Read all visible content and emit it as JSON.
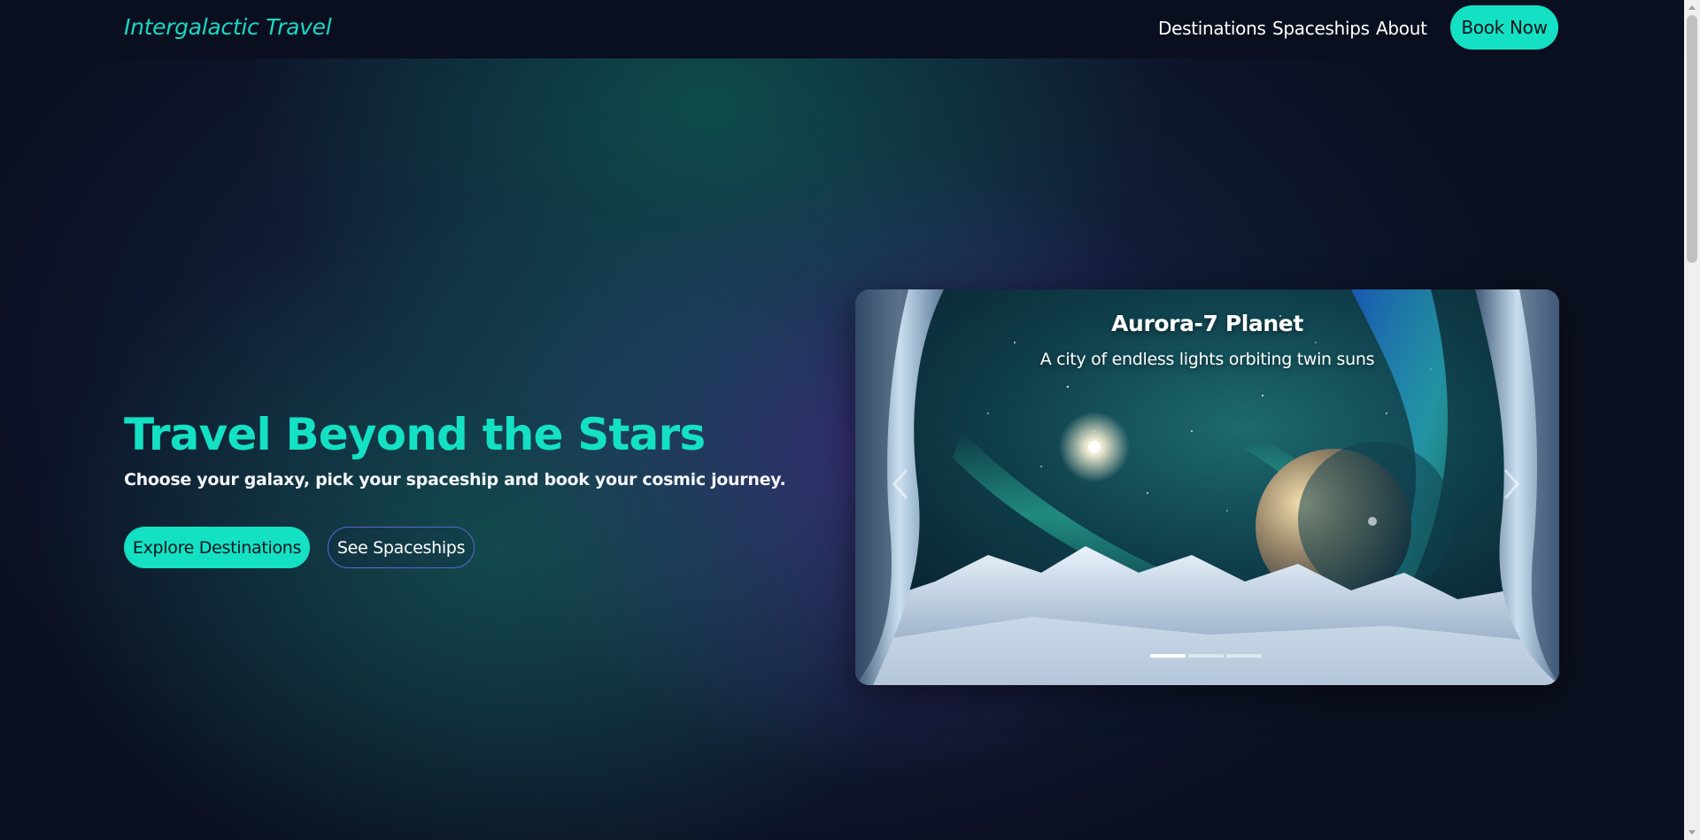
{
  "header": {
    "brand": "Intergalactic Travel",
    "nav": {
      "destinations": "Destinations",
      "spaceships": "Spaceships",
      "about": "About"
    },
    "book_now": "Book Now"
  },
  "hero": {
    "title": "Travel Beyond the Stars",
    "subtitle": "Choose your galaxy, pick your spaceship and book your cosmic journey.",
    "primary_button": "Explore Destinations",
    "secondary_button": "See Spaceships"
  },
  "carousel": {
    "active_index": 0,
    "slide_count": 3,
    "slide": {
      "title": "Aurora-7 Planet",
      "description": "A city of endless lights orbiting twin suns"
    },
    "prev_icon": "chevron-left-icon",
    "next_icon": "chevron-right-icon"
  },
  "colors": {
    "accent": "#14e0c4",
    "header_bg": "#0a0f1f",
    "outline_button": "#5a67d8"
  }
}
